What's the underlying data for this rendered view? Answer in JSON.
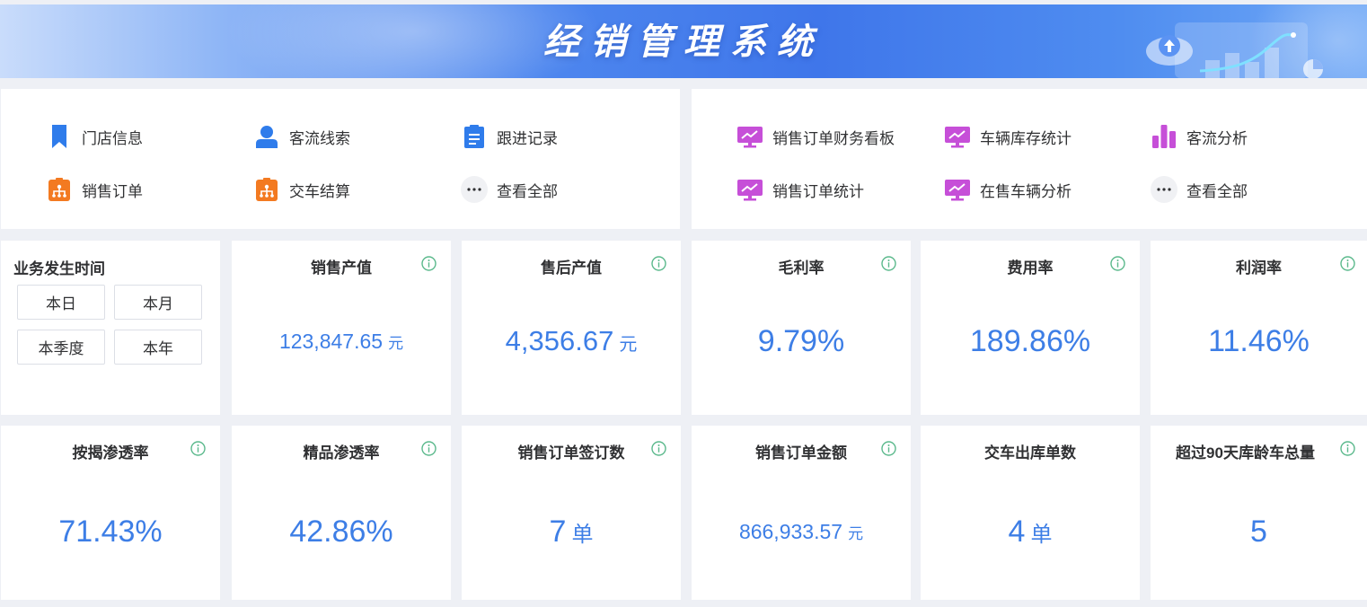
{
  "header": {
    "title": "经销管理系统"
  },
  "quick_nav_left": [
    {
      "label": "门店信息",
      "icon": "bookmark-icon"
    },
    {
      "label": "客流线索",
      "icon": "user-icon"
    },
    {
      "label": "跟进记录",
      "icon": "clipboard-icon"
    },
    {
      "label": "销售订单",
      "icon": "org-chart-icon"
    },
    {
      "label": "交车结算",
      "icon": "org-chart-icon"
    },
    {
      "label": "查看全部",
      "icon": "more-icon"
    }
  ],
  "quick_nav_right": [
    {
      "label": "销售订单财务看板",
      "icon": "monitor-chart-icon"
    },
    {
      "label": "车辆库存统计",
      "icon": "monitor-chart-icon"
    },
    {
      "label": "客流分析",
      "icon": "bar-chart-icon"
    },
    {
      "label": "销售订单统计",
      "icon": "monitor-chart-icon"
    },
    {
      "label": "在售车辆分析",
      "icon": "monitor-chart-icon"
    },
    {
      "label": "查看全部",
      "icon": "more-icon"
    }
  ],
  "time_filter": {
    "title": "业务发生时间",
    "options": [
      "本日",
      "本月",
      "本季度",
      "本年"
    ]
  },
  "metrics": [
    {
      "title": "销售产值",
      "value": "123,847.65",
      "unit": "元"
    },
    {
      "title": "售后产值",
      "value": "4,356.67",
      "unit": "元"
    },
    {
      "title": "毛利率",
      "value": "9.79%",
      "unit": ""
    },
    {
      "title": "费用率",
      "value": "189.86%",
      "unit": ""
    },
    {
      "title": "利润率",
      "value": "11.46%",
      "unit": ""
    },
    {
      "title": "按揭渗透率",
      "value": "71.43%",
      "unit": ""
    },
    {
      "title": "精品渗透率",
      "value": "42.86%",
      "unit": ""
    },
    {
      "title": "销售订单签订数",
      "value": "7",
      "unit": "单"
    },
    {
      "title": "销售订单金额",
      "value": "866,933.57",
      "unit": "元"
    },
    {
      "title": "交车出库单数",
      "value": "4",
      "unit": "单"
    },
    {
      "title": "超过90天库龄车总量",
      "value": "5",
      "unit": ""
    }
  ],
  "colors": {
    "accent_blue": "#3d7ee6",
    "nav_blue": "#2f7ceb",
    "nav_orange": "#f37a21",
    "nav_purple": "#c64fd8",
    "info_green": "#5bb98c"
  }
}
